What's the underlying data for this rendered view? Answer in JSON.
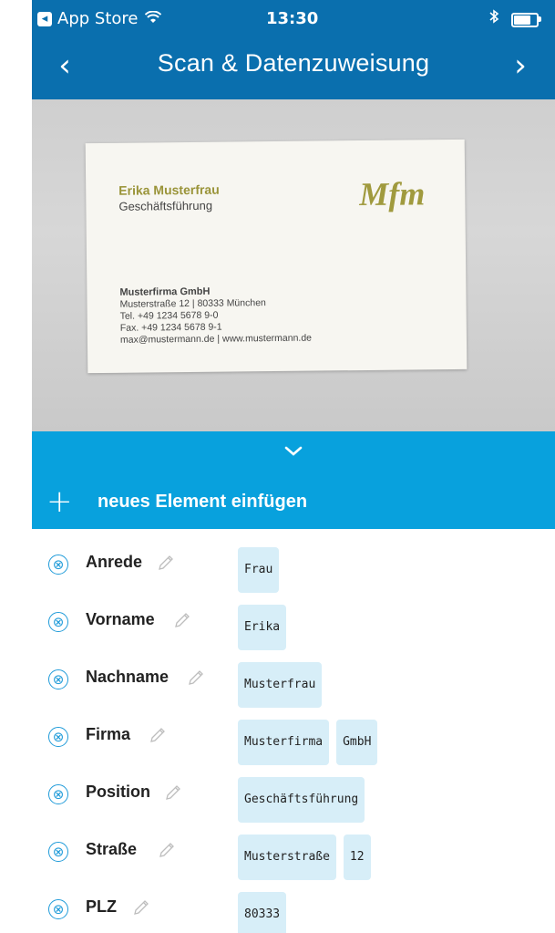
{
  "status_bar": {
    "back_app_label": "App Store",
    "back_app_icon": "back-triangle-icon",
    "wifi_icon": "wifi-icon",
    "time": "13:30",
    "bluetooth_icon": "bluetooth-icon",
    "battery_level": 0.8
  },
  "nav": {
    "title": "Scan & Datenzuweisung",
    "back_icon": "chevron-left-icon",
    "forward_icon": "chevron-right-icon",
    "back_glyph": "‹",
    "forward_glyph": "›"
  },
  "card": {
    "name": "Erika Musterfrau",
    "role": "Geschäftsführung",
    "logo": "Mfm",
    "company": "Musterfirma GmbH",
    "address": "Musterstraße 12 | 80333 München",
    "tel": "Tel. +49 1234 5678 9-0",
    "fax": "Fax. +49 1234 5678 9-1",
    "web": "max@mustermann.de | www.mustermann.de"
  },
  "collapse": {
    "glyph": "⌄",
    "icon": "chevron-down-icon"
  },
  "insert": {
    "glyph": "+",
    "label": "neues Element einfügen",
    "icon": "plus-icon"
  },
  "fields": [
    {
      "label": "Anrede",
      "chips": [
        "Frau"
      ]
    },
    {
      "label": "Vorname",
      "chips": [
        "Erika"
      ]
    },
    {
      "label": "Nachname",
      "chips": [
        "Musterfrau"
      ]
    },
    {
      "label": "Firma",
      "chips": [
        "Musterfirma",
        "GmbH"
      ]
    },
    {
      "label": "Position",
      "chips": [
        "Geschäftsführung"
      ]
    },
    {
      "label": "Straße",
      "chips": [
        "Musterstraße",
        "12"
      ]
    },
    {
      "label": "PLZ",
      "chips": [
        "80333"
      ]
    }
  ],
  "icons": {
    "remove": "⊗",
    "edit": "✎"
  },
  "colors": {
    "nav_blue": "#0a6fae",
    "accent_blue": "#08a1dd",
    "chip_bg": "#d7eef8",
    "logo_olive": "#a09a3e"
  }
}
